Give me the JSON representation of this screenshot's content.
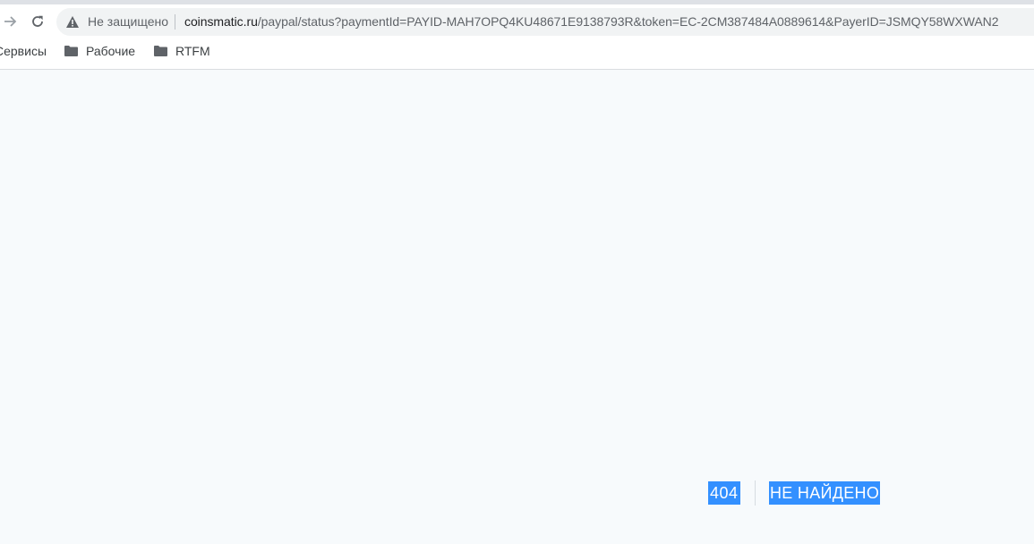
{
  "browser": {
    "security_label": "Не защищено",
    "url_host": "coinsmatic.ru",
    "url_path": "/paypal/status?paymentId=PAYID-MAH7OPQ4KU48671E9138793R&token=EC-2CM387484A0889614&PayerID=JSMQY58WXWAN2",
    "icons": {
      "forward": "forward-arrow-icon",
      "reload": "reload-icon",
      "security": "warning-triangle-icon",
      "folder": "folder-icon"
    }
  },
  "bookmarks": [
    {
      "label": "Сервисы"
    },
    {
      "label": "Рабочие"
    },
    {
      "label": "RTFM"
    }
  ],
  "page": {
    "status_code": "404",
    "status_text": "НЕ НАЙДЕНО",
    "background": "#f7fafc",
    "selection_color": "#3390ff"
  }
}
